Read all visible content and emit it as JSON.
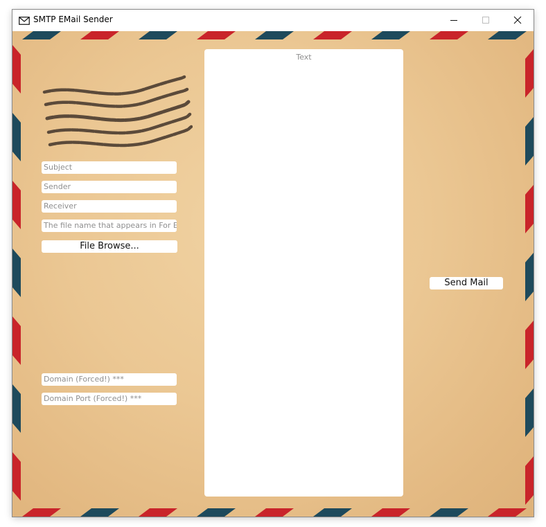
{
  "window": {
    "title": "SMTP EMail Sender",
    "icon": "envelope-icon",
    "controls": [
      "minimize-icon",
      "maximize-icon",
      "close-icon"
    ]
  },
  "form": {
    "subject_placeholder": "Subject",
    "sender_placeholder": "Sender",
    "receiver_placeholder": "Receiver",
    "filename_placeholder": "The file name that appears in For E-Mail",
    "file_browse_label": "File Browse...",
    "domain_placeholder": "Domain (Forced!) ***",
    "domain_port_placeholder": "Domain Port (Forced!) ***"
  },
  "body": {
    "text_placeholder": "Text"
  },
  "actions": {
    "send_label": "Send Mail"
  },
  "colors": {
    "envelope": "#ebc793",
    "stripe_red": "#c9242a",
    "stripe_blue": "#1e4a5c",
    "postmark": "#5b4a3a"
  }
}
